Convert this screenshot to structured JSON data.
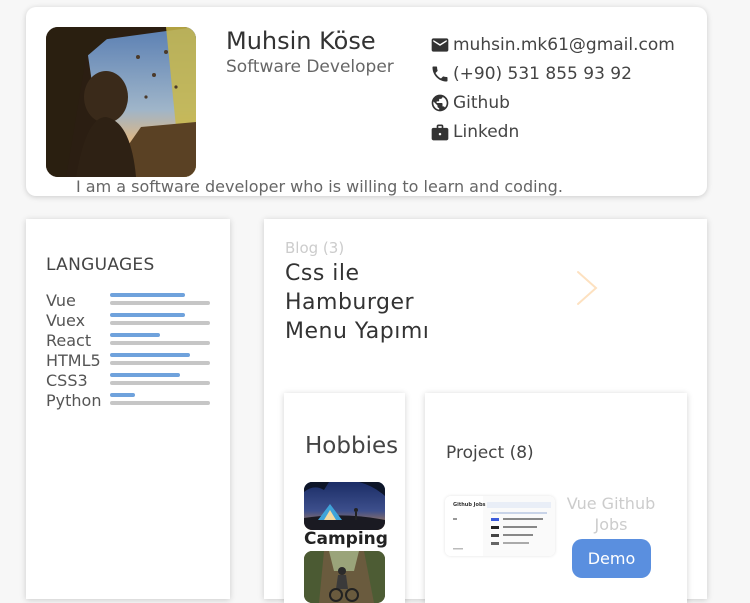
{
  "profile": {
    "name": "Muhsin Köse",
    "role": "Software Developer",
    "bio": "I am a software developer who is willing to learn and coding.",
    "avatar_icon": "person-in-tent-photo",
    "contacts": [
      {
        "icon": "mail-icon",
        "label": "muhsin.mk61@gmail.com"
      },
      {
        "icon": "phone-icon",
        "label": "(+90) 531 855 93 92"
      },
      {
        "icon": "globe-icon",
        "label": "Github"
      },
      {
        "icon": "briefcase-icon",
        "label": "Linkedn"
      }
    ]
  },
  "languages": {
    "title": "LANGUAGES",
    "items": [
      {
        "name": "Vue",
        "level": 0.75
      },
      {
        "name": "Vuex",
        "level": 0.75
      },
      {
        "name": "React",
        "level": 0.5
      },
      {
        "name": "HTML5",
        "level": 0.8
      },
      {
        "name": "CSS3",
        "level": 0.7
      },
      {
        "name": "Python",
        "level": 0.25
      }
    ],
    "bar_color": "#6fa2dc",
    "track_color": "#c6c6c6"
  },
  "blog": {
    "label": "Blog (3)",
    "title": "Css ile Hamburger Menu Yapımı",
    "thumb_colors": [
      "#f26b72",
      "#f4a35a",
      "#fdd84a",
      "#ec5a6e",
      "#f68c46",
      "#f8c84a"
    ]
  },
  "hobbies": {
    "title": "Hobbies",
    "items": [
      {
        "label": "Camping",
        "icon": "camping-photo"
      },
      {
        "label": "",
        "icon": "cycling-photo"
      }
    ]
  },
  "project": {
    "title": "Project (8)",
    "item_name": "Vue Github Jobs",
    "demo_label": "Demo",
    "thumb_text": "Github Jobs",
    "accent": "#5a8fdf"
  }
}
